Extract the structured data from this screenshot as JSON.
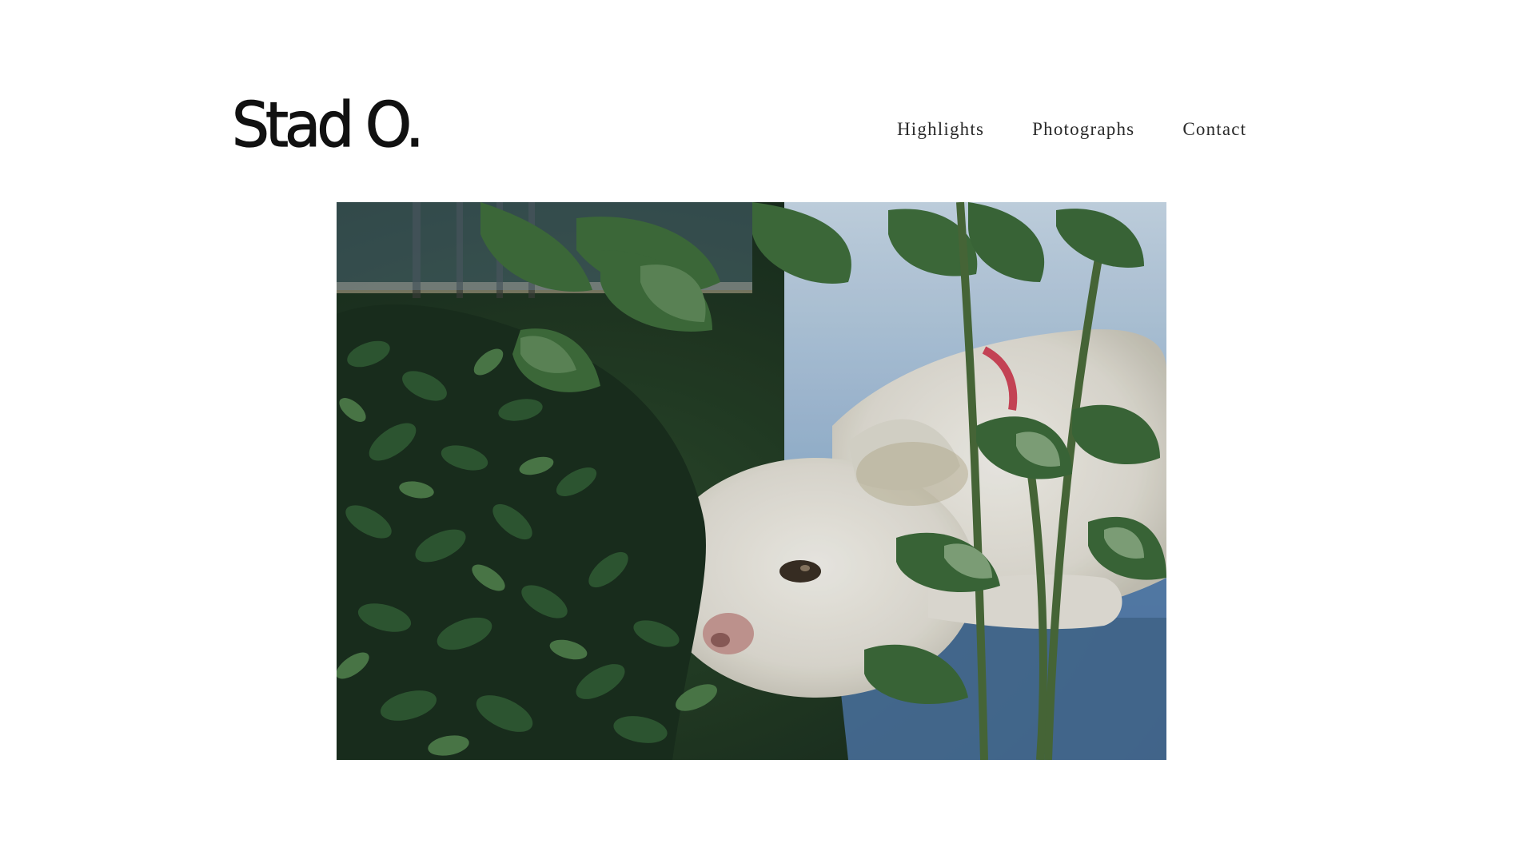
{
  "site": {
    "logo_text": "Stad O."
  },
  "nav": {
    "items": [
      {
        "label": "Highlights"
      },
      {
        "label": "Photographs"
      },
      {
        "label": "Contact"
      }
    ]
  },
  "hero": {
    "subject": "white dog among green leaves",
    "colors": {
      "foliage_dark": "#1c3320",
      "foliage_mid": "#2f5a33",
      "foliage_light": "#5f8a5a",
      "fur": "#e9e7e0",
      "sky": "#a9c4dd",
      "collar": "#d0475a"
    }
  }
}
